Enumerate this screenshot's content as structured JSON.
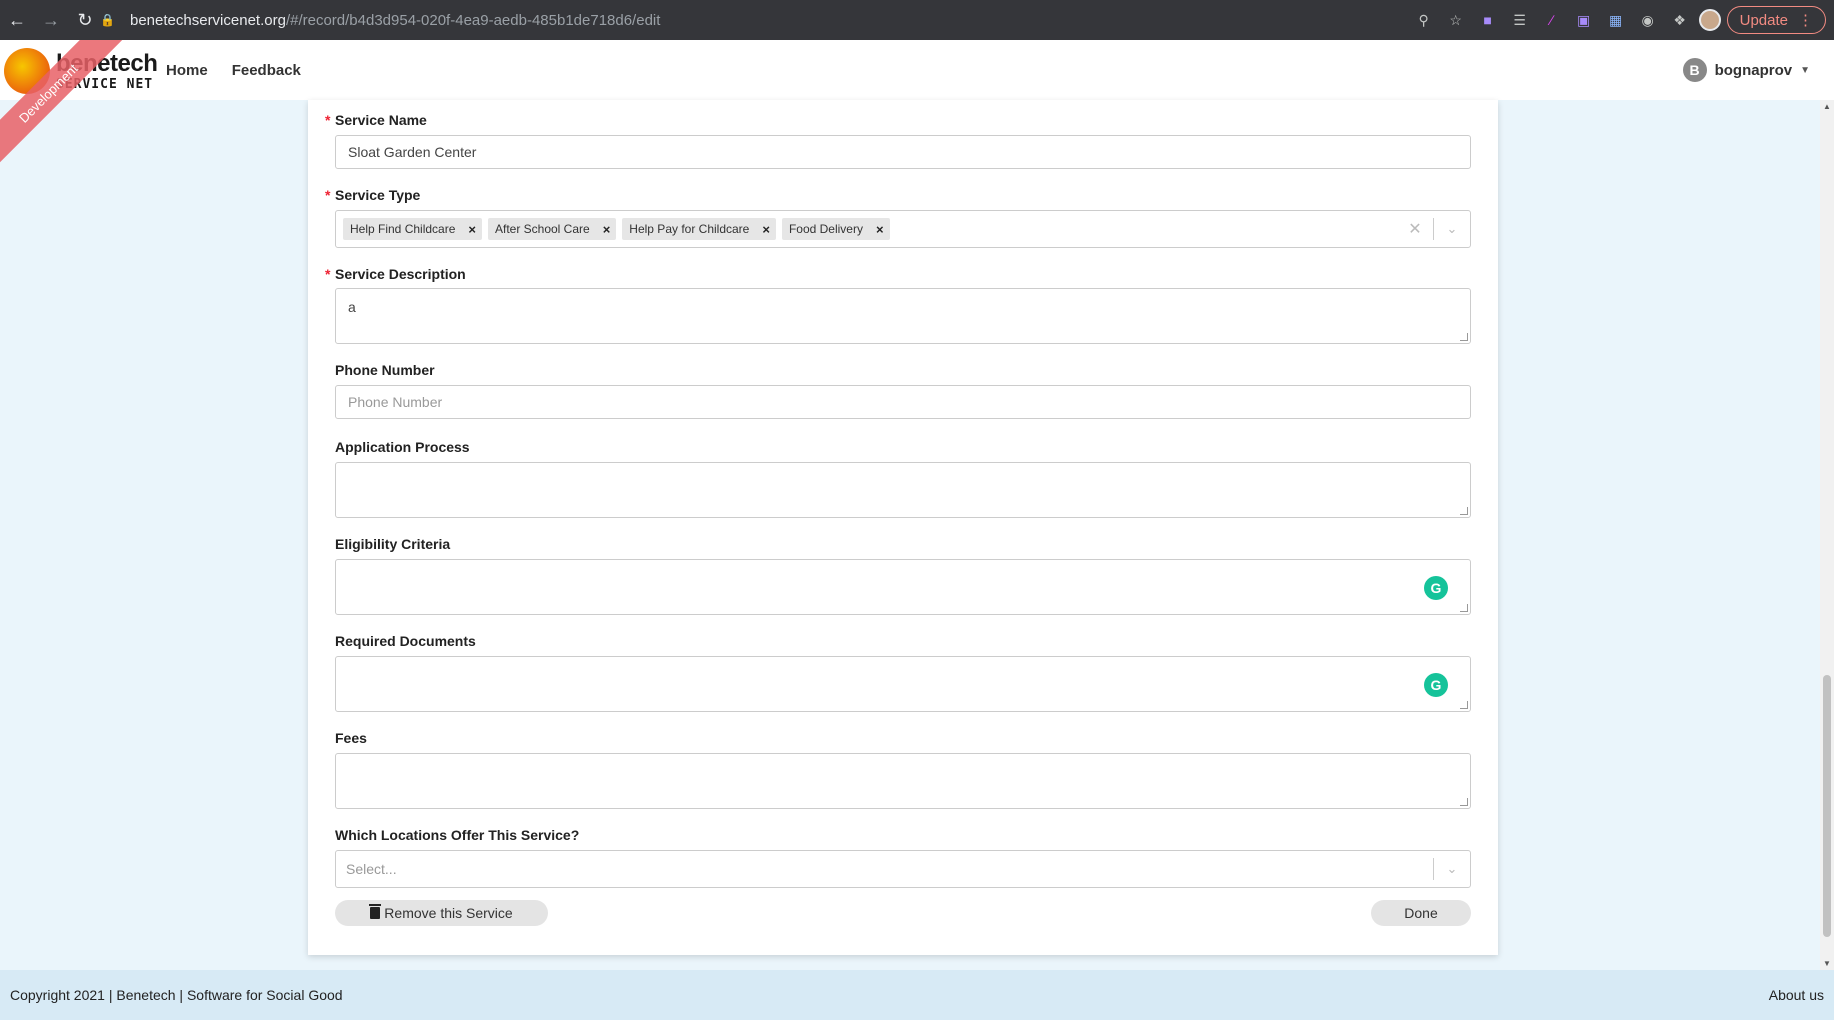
{
  "browser": {
    "url_host": "benetechservicenet.org",
    "url_path": "/#/record/b4d3d954-020f-4ea9-aedb-485b1de718d6/edit",
    "update_label": "Update"
  },
  "app": {
    "logo_name": "benetech",
    "logo_sub": "SERVICE NET",
    "ribbon": "Development",
    "nav": {
      "home": "Home",
      "feedback": "Feedback"
    },
    "user": {
      "initial": "B",
      "name": "bognaprov"
    }
  },
  "form": {
    "service_name": {
      "label": "Service Name",
      "value": "Sloat Garden Center"
    },
    "service_type": {
      "label": "Service Type",
      "tags": [
        "Help Find Childcare",
        "After School Care",
        "Help Pay for Childcare",
        "Food Delivery"
      ]
    },
    "service_description": {
      "label": "Service Description",
      "value": "a"
    },
    "phone_number": {
      "label": "Phone Number",
      "placeholder": "Phone Number"
    },
    "application_process": {
      "label": "Application Process"
    },
    "eligibility_criteria": {
      "label": "Eligibility Criteria"
    },
    "required_documents": {
      "label": "Required Documents"
    },
    "fees": {
      "label": "Fees"
    },
    "locations": {
      "label": "Which Locations Offer This Service?",
      "placeholder": "Select..."
    },
    "remove_button": "Remove this Service",
    "done_button": "Done"
  },
  "footer": {
    "copyright": "Copyright 2021 | Benetech | Software for Social Good",
    "about": "About us"
  },
  "colors": {
    "required": "#ee2233",
    "grammarly": "#15c39a",
    "footer_bg": "#d7eaf5",
    "page_bg": "#eaf5fb"
  }
}
